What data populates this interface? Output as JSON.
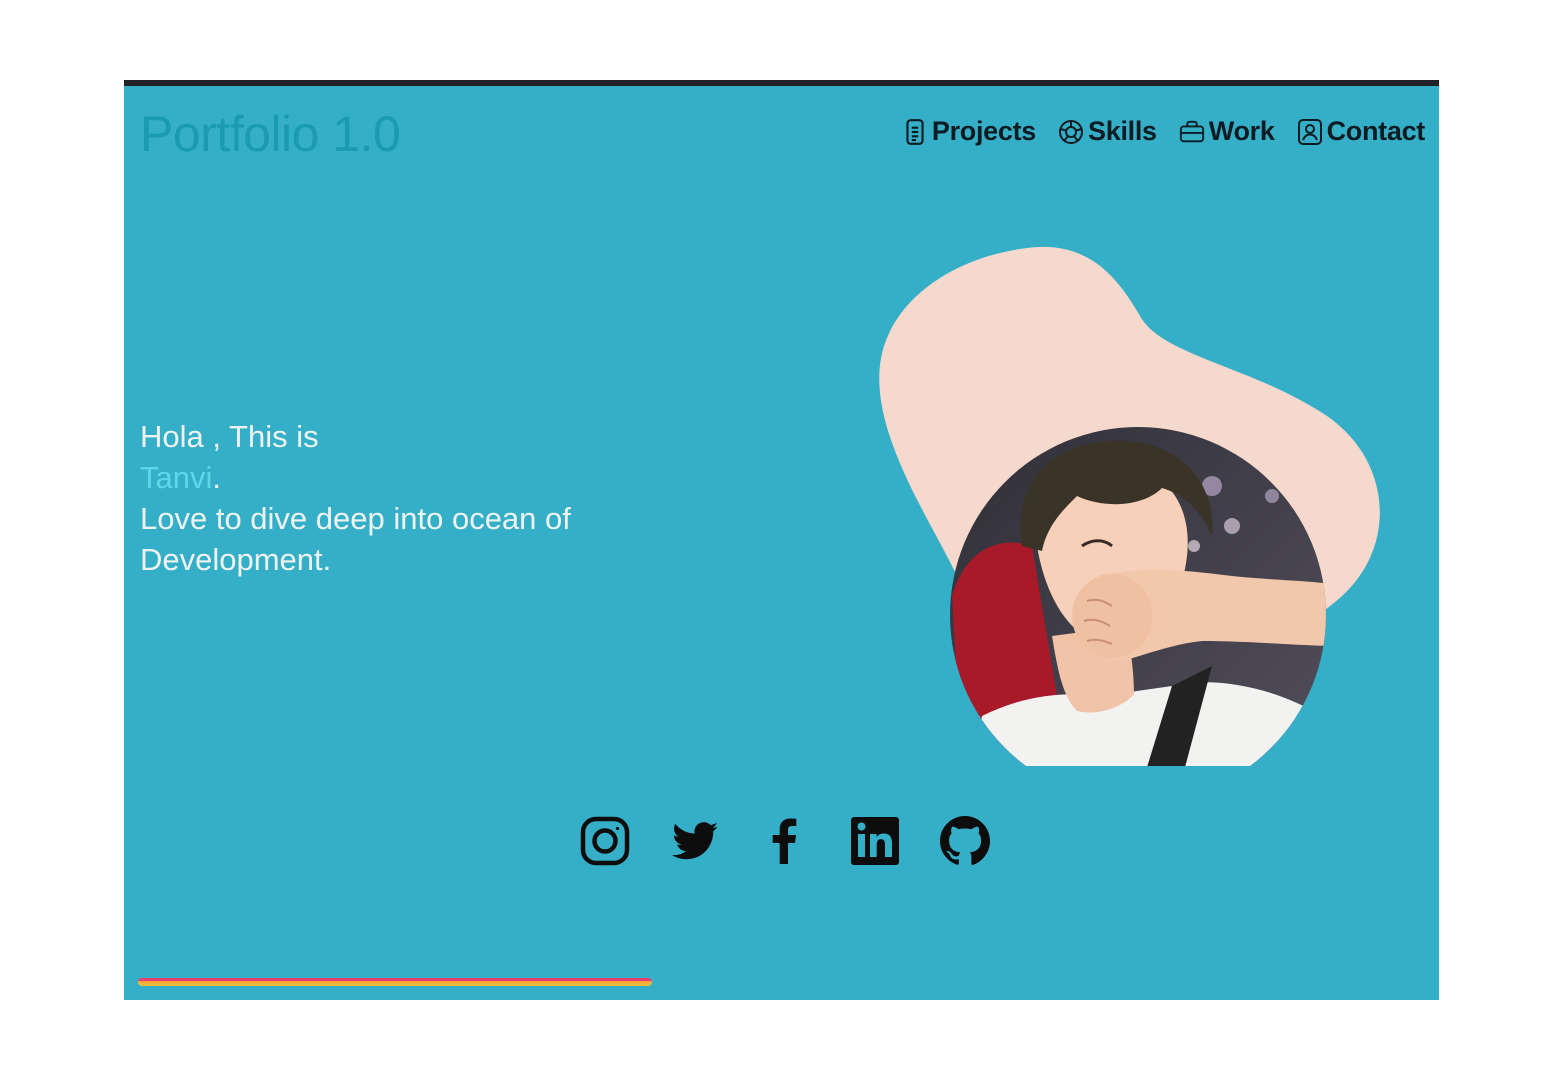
{
  "brand": {
    "title": "Portfolio 1.0"
  },
  "nav": {
    "items": [
      {
        "label": "Projects",
        "icon": "document-icon"
      },
      {
        "label": "Skills",
        "icon": "badge-icon"
      },
      {
        "label": "Work",
        "icon": "briefcase-icon"
      },
      {
        "label": "Contact",
        "icon": "contact-card-icon"
      }
    ]
  },
  "hero": {
    "greeting": "Hola , This is",
    "name": "Tanvi",
    "name_suffix": ".",
    "tagline_line1": "Love to dive deep into ocean of",
    "tagline_line2": "Development."
  },
  "social": [
    {
      "icon": "instagram-icon"
    },
    {
      "icon": "twitter-icon"
    },
    {
      "icon": "facebook-icon"
    },
    {
      "icon": "linkedin-icon"
    },
    {
      "icon": "github-icon"
    }
  ],
  "colors": {
    "background": "#35afc7",
    "brand_text": "#1a9bb0",
    "name_accent": "#5fd6ea",
    "blob": "#f6d9cd",
    "top_border": "#222326"
  }
}
